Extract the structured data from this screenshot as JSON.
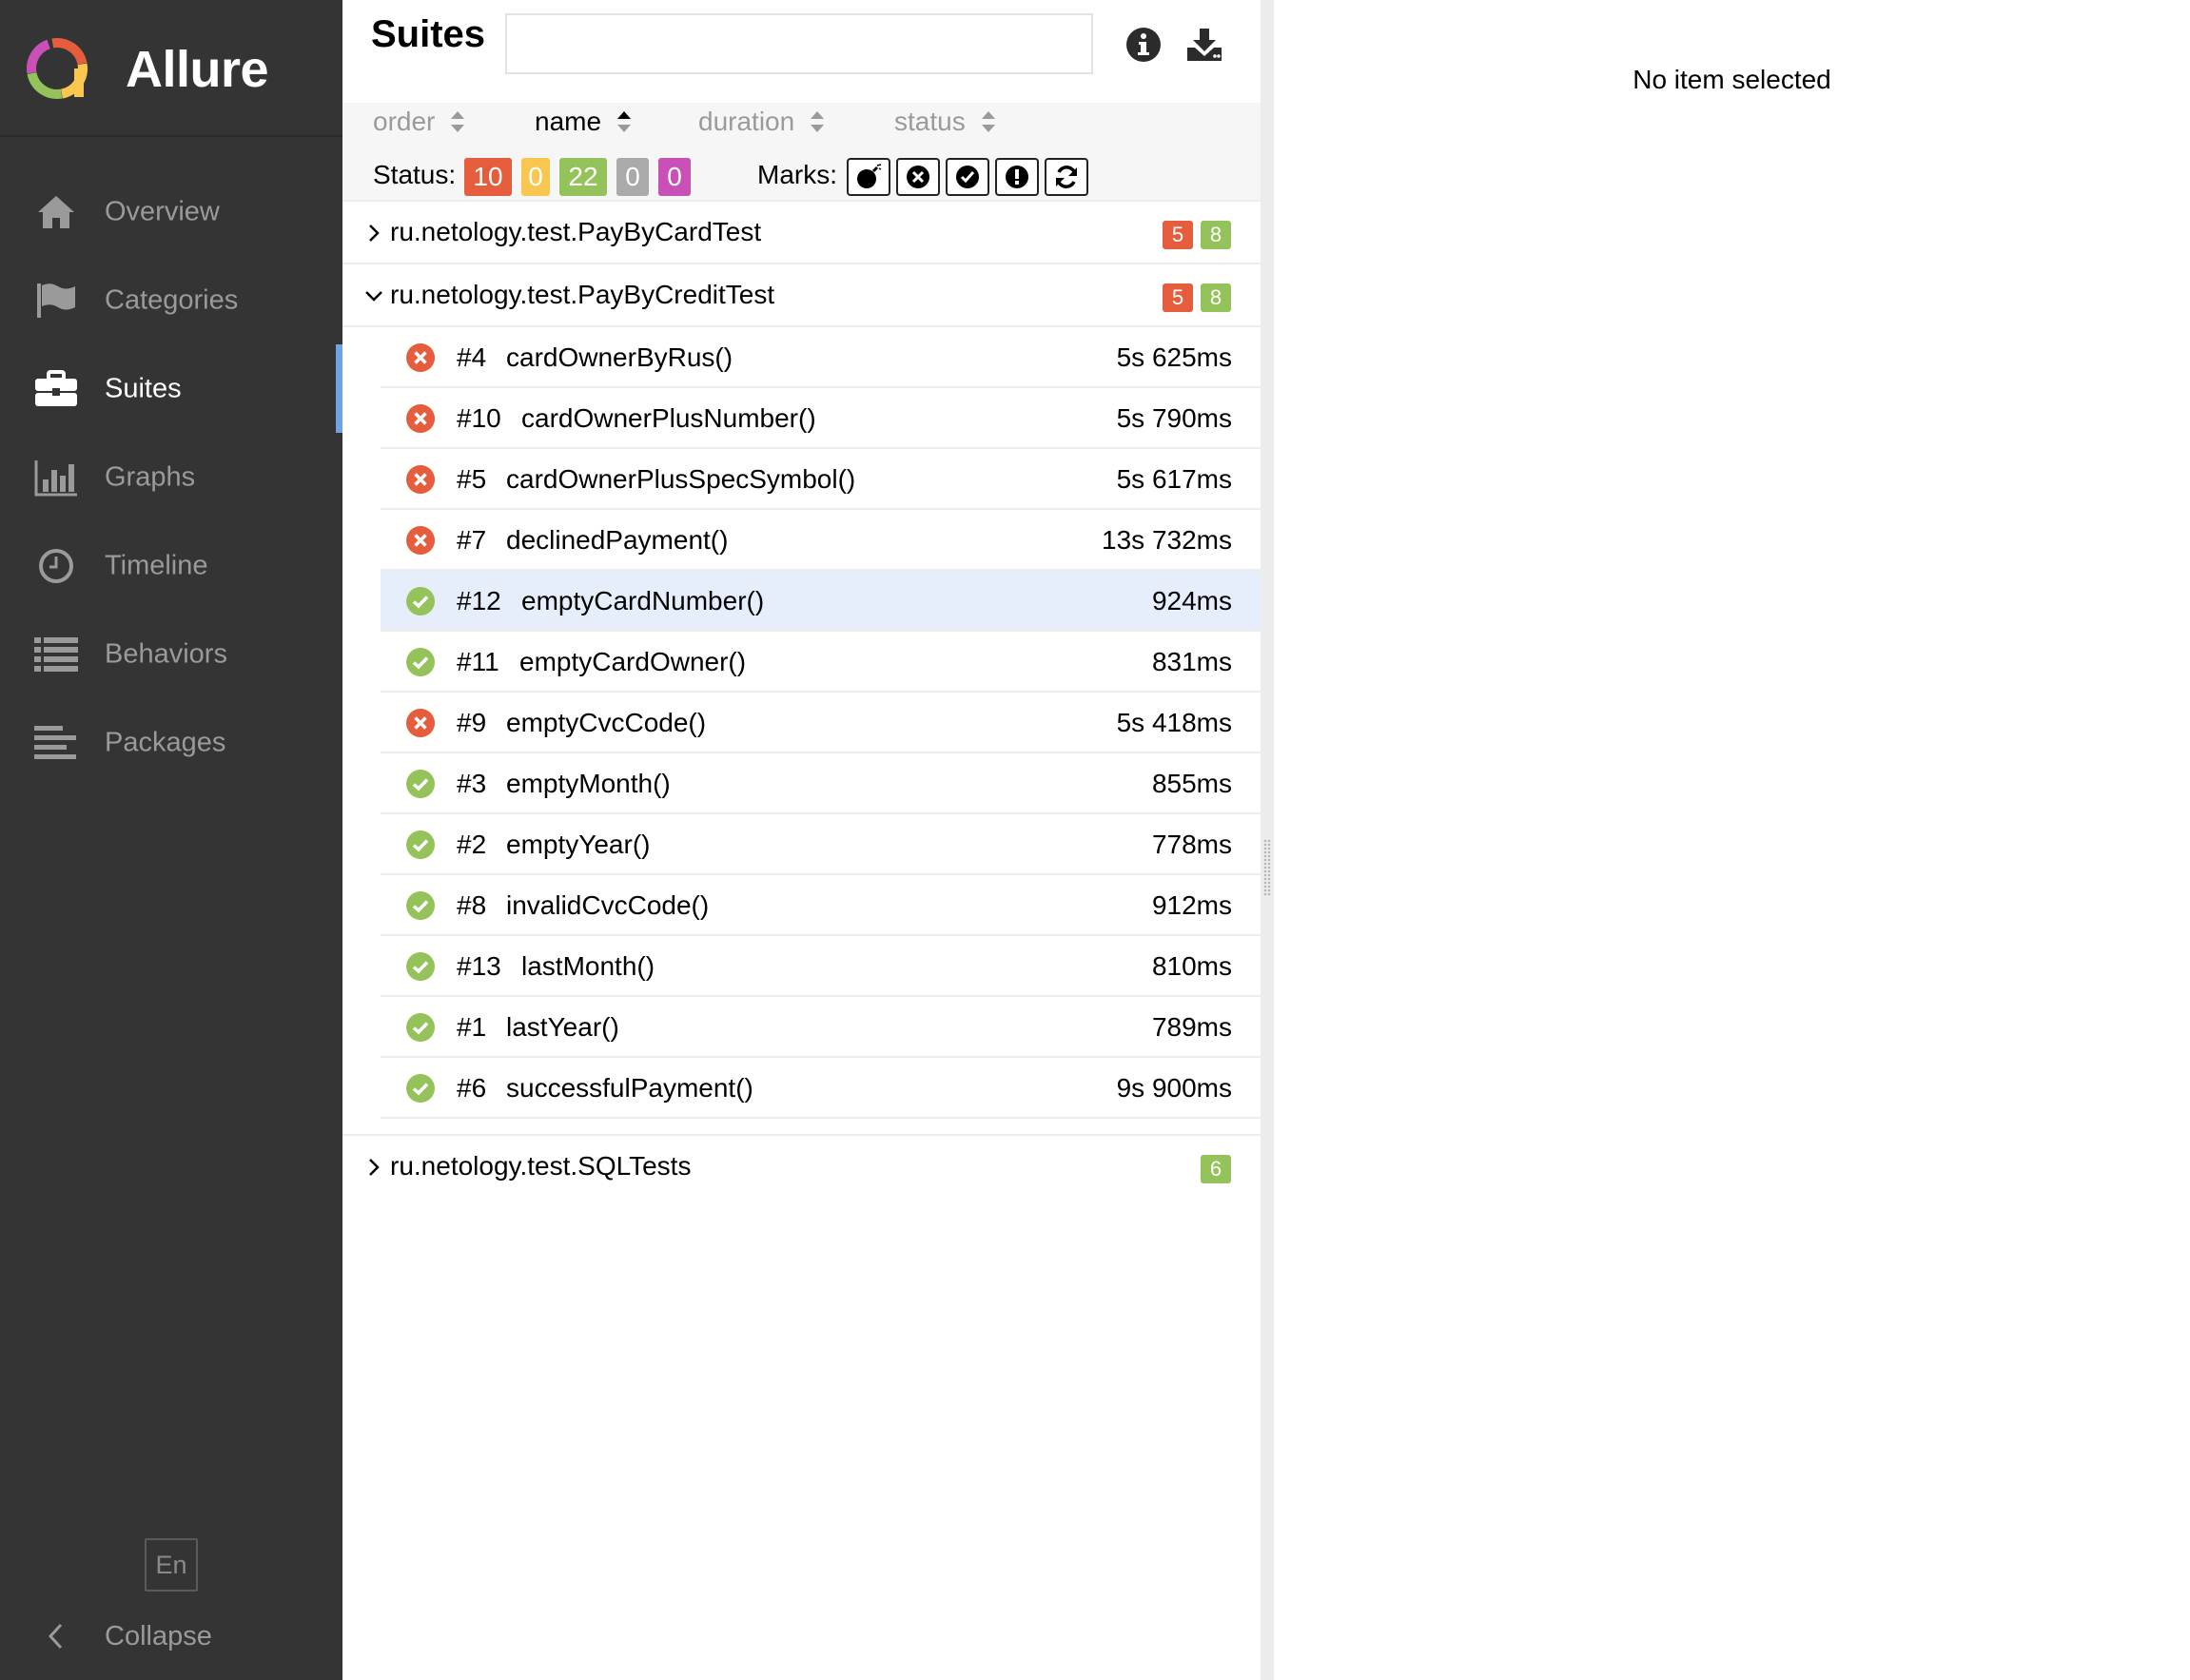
{
  "brand": {
    "name": "Allure"
  },
  "sidebar": {
    "items": [
      {
        "label": "Overview",
        "icon": "home-icon",
        "active": false
      },
      {
        "label": "Categories",
        "icon": "flag-icon",
        "active": false
      },
      {
        "label": "Suites",
        "icon": "briefcase-icon",
        "active": true
      },
      {
        "label": "Graphs",
        "icon": "bar-chart-icon",
        "active": false
      },
      {
        "label": "Timeline",
        "icon": "clock-icon",
        "active": false
      },
      {
        "label": "Behaviors",
        "icon": "list-icon",
        "active": false
      },
      {
        "label": "Packages",
        "icon": "align-left-icon",
        "active": false
      }
    ],
    "language": "En",
    "collapse_label": "Collapse"
  },
  "header": {
    "title": "Suites",
    "search": {
      "value": "",
      "placeholder": ""
    },
    "info_icon": "info-icon",
    "download_icon": "download-icon"
  },
  "sort": {
    "order": "order",
    "name": "name",
    "duration": "duration",
    "status": "status",
    "active": "name"
  },
  "filters": {
    "status_label": "Status:",
    "statuses": [
      {
        "name": "failed",
        "count": "10",
        "color": "#e55d3d"
      },
      {
        "name": "broken",
        "count": "0",
        "color": "#f9c74f"
      },
      {
        "name": "passed",
        "count": "22",
        "color": "#94c35b"
      },
      {
        "name": "skipped",
        "count": "0",
        "color": "#aaaaaa"
      },
      {
        "name": "unknown",
        "count": "0",
        "color": "#c950b6"
      }
    ],
    "marks_label": "Marks:",
    "marks": [
      "bomb-icon",
      "times-circle-icon",
      "check-circle-icon",
      "exclamation-circle-icon",
      "refresh-icon"
    ]
  },
  "colors": {
    "failed": "#e55d3d",
    "passed": "#94c35b",
    "sidebar_bg": "#343434",
    "accent": "#6fa2e6",
    "selected_row": "#e6eefb"
  },
  "tree": {
    "groups": [
      {
        "name": "ru.netology.test.PayByCardTest",
        "expanded": false,
        "failed": "5",
        "passed": "8"
      },
      {
        "name": "ru.netology.test.PayByCreditTest",
        "expanded": true,
        "failed": "5",
        "passed": "8",
        "tests": [
          {
            "order": "#4",
            "name": "cardOwnerByRus()",
            "duration": "5s 625ms",
            "status": "failed"
          },
          {
            "order": "#10",
            "name": "cardOwnerPlusNumber()",
            "duration": "5s 790ms",
            "status": "failed"
          },
          {
            "order": "#5",
            "name": "cardOwnerPlusSpecSymbol()",
            "duration": "5s 617ms",
            "status": "failed"
          },
          {
            "order": "#7",
            "name": "declinedPayment()",
            "duration": "13s 732ms",
            "status": "failed"
          },
          {
            "order": "#12",
            "name": "emptyCardNumber()",
            "duration": "924ms",
            "status": "passed",
            "selected": true
          },
          {
            "order": "#11",
            "name": "emptyCardOwner()",
            "duration": "831ms",
            "status": "passed"
          },
          {
            "order": "#9",
            "name": "emptyCvcCode()",
            "duration": "5s 418ms",
            "status": "failed"
          },
          {
            "order": "#3",
            "name": "emptyMonth()",
            "duration": "855ms",
            "status": "passed"
          },
          {
            "order": "#2",
            "name": "emptyYear()",
            "duration": "778ms",
            "status": "passed"
          },
          {
            "order": "#8",
            "name": "invalidCvcCode()",
            "duration": "912ms",
            "status": "passed"
          },
          {
            "order": "#13",
            "name": "lastMonth()",
            "duration": "810ms",
            "status": "passed"
          },
          {
            "order": "#1",
            "name": "lastYear()",
            "duration": "789ms",
            "status": "passed"
          },
          {
            "order": "#6",
            "name": "successfulPayment()",
            "duration": "9s 900ms",
            "status": "passed"
          }
        ]
      },
      {
        "name": "ru.netology.test.SQLTests",
        "expanded": false,
        "passed": "6"
      }
    ]
  },
  "detail": {
    "empty_text": "No item selected"
  }
}
